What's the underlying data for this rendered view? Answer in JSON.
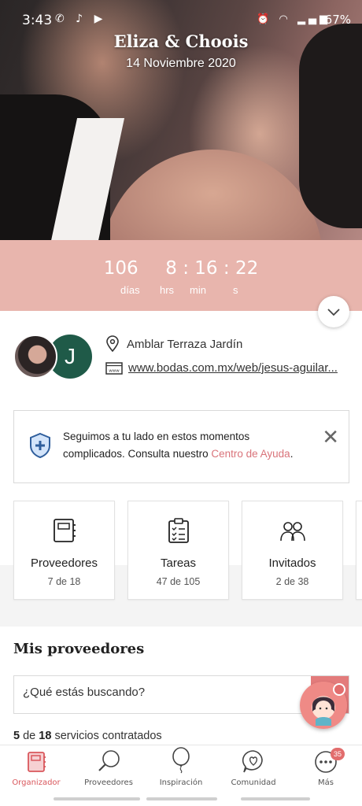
{
  "status_bar": {
    "time": "3:43",
    "battery": "67%"
  },
  "hero": {
    "couple_names": "Eliza & Choois",
    "wedding_date": "14 Noviembre 2020"
  },
  "countdown": {
    "days": "106",
    "hours": "8",
    "minutes": "16",
    "seconds": "22",
    "days_label": "días",
    "hours_label": "hrs",
    "minutes_label": "min",
    "seconds_label": "s"
  },
  "profile": {
    "avatar_letter": "J",
    "venue": "Amblar Terraza Jardín",
    "website": "www.bodas.com.mx/web/jesus-aguilar..."
  },
  "notice": {
    "text": "Seguimos a tu lado en estos momentos complicados. Consulta nuestro ",
    "link": "Centro de Ayuda",
    "suffix": "."
  },
  "cards": [
    {
      "title": "Proveedores",
      "count": "7 de 18"
    },
    {
      "title": "Tareas",
      "count": "47 de 105"
    },
    {
      "title": "Invitados",
      "count": "2 de 38"
    }
  ],
  "vendors": {
    "section_title": "Mis proveedores",
    "search_placeholder": "¿Qué estás buscando?",
    "contracted_done": "5",
    "contracted_of": "de",
    "contracted_total": "18",
    "contracted_suffix": "servicios contratados"
  },
  "bottom_nav": {
    "items": [
      {
        "label": "Organizador"
      },
      {
        "label": "Proveedores"
      },
      {
        "label": "Inspiración"
      },
      {
        "label": "Comunidad"
      },
      {
        "label": "Más"
      }
    ],
    "more_badge": "35"
  },
  "colors": {
    "accent": "#d9575c",
    "countdown_bg": "#e8b5ad",
    "avatar_green": "#1f5a48",
    "link_pink": "#d9737a"
  }
}
